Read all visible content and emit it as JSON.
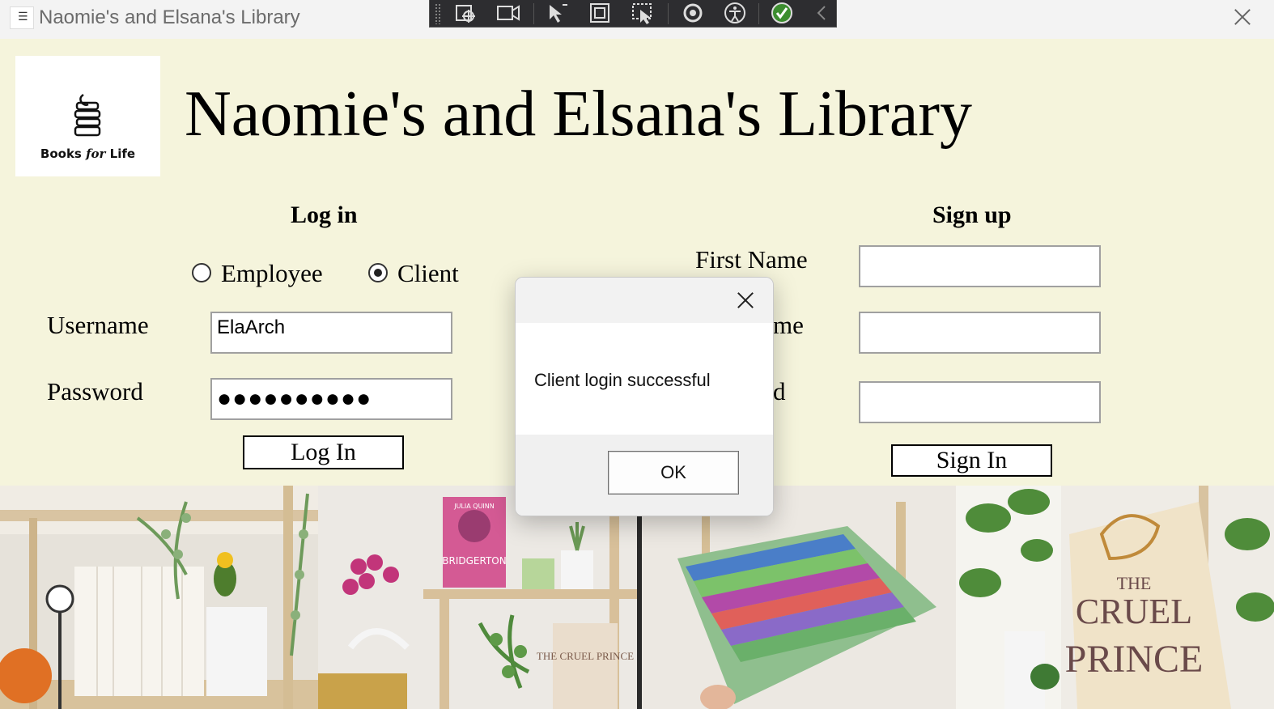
{
  "window": {
    "title": "Naomie's and Elsana's Library"
  },
  "logo": {
    "caption_a": "Books ",
    "caption_b": "for",
    "caption_c": " Life"
  },
  "page": {
    "heading": "Naomie's and Elsana's Library"
  },
  "login": {
    "heading": "Log in",
    "role_employee": "Employee",
    "role_client": "Client",
    "selected_role": "Client",
    "username_label": "Username",
    "username_value": "ElaArch",
    "password_label": "Password",
    "password_mask": "●●●●●●●●●●",
    "button": "Log In"
  },
  "signup": {
    "heading": "Sign up",
    "first_name_label": "First Name",
    "last_name_label_visible": "me",
    "password_label_visible": "d",
    "button": "Sign In"
  },
  "dialog": {
    "message": "Client login successful",
    "ok": "OK"
  },
  "photos": {
    "book1": "BRIDGERTON",
    "book1_author": "JULIA QUINN",
    "book2": "THE CRUEL PRINCE",
    "book3_a": "THE",
    "book3_b": "CRUEL",
    "book3_c": "PRINCE"
  }
}
